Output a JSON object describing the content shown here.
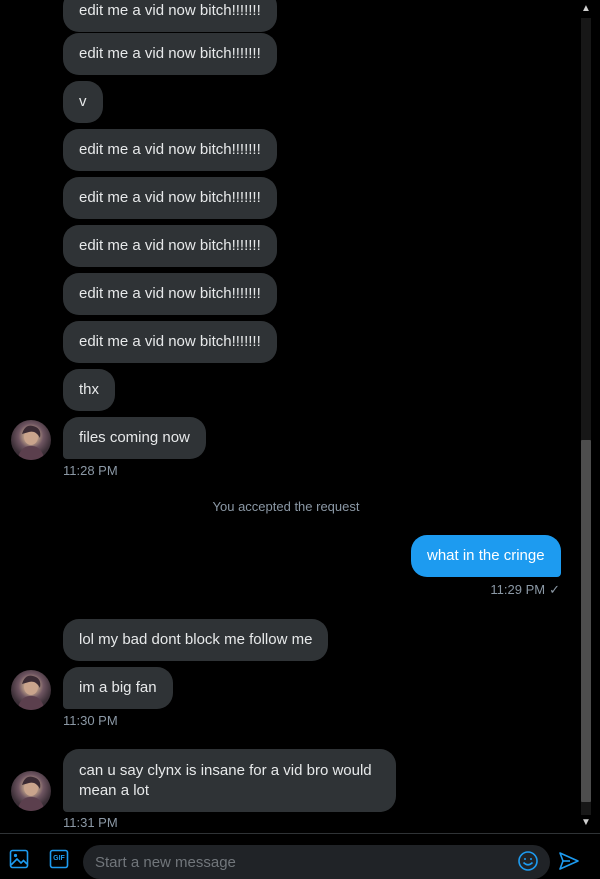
{
  "conversation": {
    "incoming_messages": [
      {
        "text": "edit me a vid now bitch!!!!!!!"
      },
      {
        "text": "edit me a vid now bitch!!!!!!!"
      },
      {
        "text": "v"
      },
      {
        "text": "edit me a vid now bitch!!!!!!!"
      },
      {
        "text": "edit me a vid now bitch!!!!!!!"
      },
      {
        "text": "edit me a vid now bitch!!!!!!!"
      },
      {
        "text": "edit me a vid now bitch!!!!!!!"
      },
      {
        "text": "edit me a vid now bitch!!!!!!!"
      },
      {
        "text": "thx"
      },
      {
        "text": "files coming now"
      }
    ],
    "timestamp_1": "11:28 PM",
    "system_note": "You accepted the request",
    "outgoing_message": "what in the cringe",
    "outgoing_timestamp": "11:29 PM",
    "outgoing_status": "✓",
    "group_2": [
      "lol my bad dont block me follow me",
      "im a big fan"
    ],
    "timestamp_2": "11:30 PM",
    "group_3": [
      "can u say clynx is insane for a vid bro would mean a lot"
    ],
    "timestamp_3": "11:31 PM"
  },
  "composer": {
    "placeholder": "Start a new message",
    "icons": {
      "media": "image-icon",
      "gif": "gif-icon",
      "emoji": "emoji-icon",
      "send": "send-icon"
    },
    "gif_label": "GIF"
  },
  "colors": {
    "accent": "#1d9bf0",
    "incoming_bubble": "#2f3336",
    "background": "#000000",
    "muted_text": "#8b98a5"
  },
  "scrollbar": {
    "position": 0.95
  }
}
